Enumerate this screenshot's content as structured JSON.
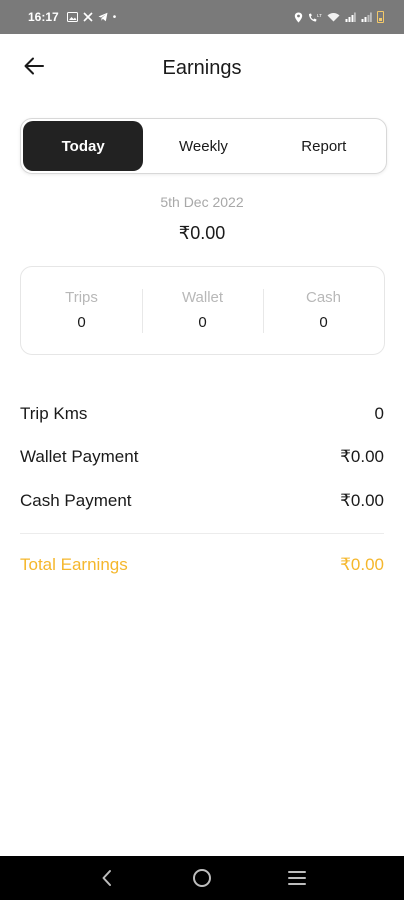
{
  "status_bar": {
    "time": "16:17",
    "dot": "•"
  },
  "header": {
    "title": "Earnings",
    "back_icon": "arrow-left-icon"
  },
  "tabs": [
    {
      "label": "Today",
      "active": true
    },
    {
      "label": "Weekly",
      "active": false
    },
    {
      "label": "Report",
      "active": false
    }
  ],
  "summary": {
    "date": "5th Dec 2022",
    "amount": "₹0.00"
  },
  "stats": [
    {
      "label": "Trips",
      "value": "0"
    },
    {
      "label": "Wallet",
      "value": "0"
    },
    {
      "label": "Cash",
      "value": "0"
    }
  ],
  "details": [
    {
      "label": "Trip Kms",
      "value": "0"
    },
    {
      "label": "Wallet Payment",
      "value": "₹0.00"
    },
    {
      "label": "Cash Payment",
      "value": "₹0.00"
    }
  ],
  "total": {
    "label": "Total Earnings",
    "value": "₹0.00"
  },
  "colors": {
    "accent": "#f5b72c",
    "active_tab": "#222222",
    "status_bar": "#7a7a7a"
  }
}
